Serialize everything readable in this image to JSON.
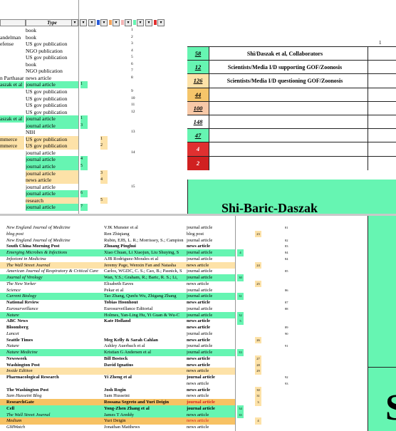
{
  "header": {
    "type_label": "Type",
    "col_number_top": "1"
  },
  "colors": {
    "green": "#66f5b2",
    "yellow": "#fde2a8",
    "red": "#e03030",
    "orange": "#f5a35a",
    "blue": "#2a5bd7",
    "pink": "#f3b4b4"
  },
  "top_rows": [
    {
      "src": "",
      "type": "book",
      "c1": "",
      "c2": "",
      "num": "1",
      "hl": ""
    },
    {
      "src": "andelman",
      "type": "book",
      "c1": "",
      "c2": "",
      "num": "2",
      "hl": ""
    },
    {
      "src": "efense",
      "type": "US gov publication",
      "c1": "",
      "c2": "",
      "num": "3",
      "hl": ""
    },
    {
      "src": "",
      "type": "NGO publication",
      "c1": "",
      "c2": "",
      "num": "4",
      "hl": ""
    },
    {
      "src": "",
      "type": "US gov publication",
      "c1": "",
      "c2": "",
      "num": "5",
      "hl": ""
    },
    {
      "src": "",
      "type": "book",
      "c1": "",
      "c2": "",
      "num": "6",
      "hl": ""
    },
    {
      "src": "",
      "type": "NGO publication",
      "c1": "",
      "c2": "",
      "num": "7",
      "hl": ""
    },
    {
      "src": "n Parthasar",
      "type": "news article",
      "c1": "",
      "c2": "",
      "num": "8",
      "hl": ""
    },
    {
      "src": "aszak et al",
      "type": "journal article",
      "c1": "1",
      "c2": "",
      "num": "",
      "hl": "g"
    },
    {
      "src": "",
      "type": "US gov publication",
      "c1": "",
      "c2": "",
      "num": "9",
      "hl": ""
    },
    {
      "src": "",
      "type": "US gov publication",
      "c1": "",
      "c2": "",
      "num": "10",
      "hl": ""
    },
    {
      "src": "",
      "type": "US gov publication",
      "c1": "",
      "c2": "",
      "num": "11",
      "hl": ""
    },
    {
      "src": "",
      "type": "US gov publication",
      "c1": "",
      "c2": "",
      "num": "12",
      "hl": ""
    },
    {
      "src": "aszak et al",
      "type": "journal article",
      "c1": "1",
      "c2": "",
      "num": "",
      "hl": "g"
    },
    {
      "src": "",
      "type": "journal article",
      "c1": "3",
      "c2": "",
      "num": "",
      "hl": "g"
    },
    {
      "src": "",
      "type": "NIH",
      "c1": "",
      "c2": "",
      "num": "13",
      "hl": ""
    },
    {
      "src": "mmerce",
      "type": "US gov publication",
      "c1": "",
      "c2": "1",
      "num": "",
      "hl": "y"
    },
    {
      "src": "mmerce",
      "type": "US gov publication",
      "c1": "",
      "c2": "2",
      "num": "",
      "hl": "y"
    },
    {
      "src": "",
      "type": "journal article",
      "c1": "",
      "c2": "",
      "num": "14",
      "hl": ""
    },
    {
      "src": "",
      "type": "journal article",
      "c1": "4",
      "c2": "",
      "num": "",
      "hl": "g"
    },
    {
      "src": "",
      "type": "journal article",
      "c1": "5",
      "c2": "",
      "num": "",
      "hl": "g"
    },
    {
      "src": "",
      "type": "journal article",
      "c1": "",
      "c2": "3",
      "num": "",
      "hl": "y"
    },
    {
      "src": "",
      "type": "news article",
      "c1": "",
      "c2": "4",
      "num": "",
      "hl": "y"
    },
    {
      "src": "",
      "type": "journal article",
      "c1": "",
      "c2": "",
      "num": "15",
      "hl": ""
    },
    {
      "src": "",
      "type": "journal article",
      "c1": "6",
      "c2": "",
      "num": "",
      "hl": "g"
    },
    {
      "src": "",
      "type": "research",
      "c1": "",
      "c2": "5",
      "num": "",
      "hl": "y"
    },
    {
      "src": "",
      "type": "journal article",
      "c1": "7",
      "c2": "",
      "num": "",
      "hl": "g"
    }
  ],
  "legend": [
    {
      "count": "58",
      "label": "Shi/Daszak et al, Collaborators",
      "color": "#66f5b2"
    },
    {
      "count": "12",
      "label": "Scientists/Media I/D supporting GOF/Zoonosis",
      "color": "#66f5b2"
    },
    {
      "count": "126",
      "label": "Scientists/Media I/D questioning GOF/Zoonosis",
      "color": "#fde2a8"
    },
    {
      "count": "44",
      "label": "",
      "color": "#f5c56a"
    },
    {
      "count": "100",
      "label": "",
      "color": "#f8c9a8"
    },
    {
      "count": "148",
      "label": "",
      "color": "#ffffff"
    },
    {
      "count": "47",
      "label": "",
      "color": "#66f5b2"
    },
    {
      "count": "4",
      "label": "",
      "color": "#e03030"
    },
    {
      "count": "2",
      "label": "",
      "color": "#d02020"
    }
  ],
  "banner": {
    "text": "Shi-Baric-Daszak"
  },
  "right_big_letter": "S",
  "bottom_rows": [
    {
      "s": "New England Journal of Medicine",
      "a": "VJK Munster et al",
      "t": "journal article",
      "b": false,
      "k1": "",
      "k2": "",
      "n": "81",
      "hl": ""
    },
    {
      "s": "blog post",
      "a": "Ren Zhiqiang",
      "t": "blog post",
      "b": false,
      "k1": "",
      "k2": "23",
      "n": "",
      "hl": ""
    },
    {
      "s": "New England Journal of Medicine",
      "a": "Rubin, EJB, L. R.; Morrissey, S.; Campion",
      "t": "journal article",
      "b": false,
      "k1": "",
      "k2": "",
      "n": "82",
      "hl": ""
    },
    {
      "s": "South China Morning Post",
      "a": "Zhuang Pinghui",
      "t": "news article",
      "b": true,
      "k1": "",
      "k2": "",
      "n": "83",
      "hl": ""
    },
    {
      "s": "Emerging Microbes & Infections",
      "a": "Xiao Chuan, Li Xiaojun, Liu Shuying, S",
      "t": "journal article",
      "b": false,
      "k1": "4",
      "k2": "",
      "n": "84",
      "hl": "g"
    },
    {
      "s": "Infezioni in Medicina",
      "a": "AJB Rodriguez-Morales et al",
      "t": "journal article",
      "b": false,
      "k1": "",
      "k2": "",
      "n": "84",
      "hl": ""
    },
    {
      "s": "The Wall Street Journal",
      "a": "Jeremy Page, Wenxin Fan and Natasha",
      "t": "news article",
      "b": false,
      "k1": "",
      "k2": "24",
      "n": "",
      "hl": "y"
    },
    {
      "s": "American Journal of Respiratory & Critical Care",
      "a": "Carlos, WGDC, C. S.; Cao, B.; Pasnick, S",
      "t": "journal article",
      "b": false,
      "k1": "",
      "k2": "",
      "n": "85",
      "hl": ""
    },
    {
      "s": "Journal of Virology",
      "a": "Wan, Y.S.; Graham, R.; Baric, R. S.; Li,",
      "t": "journal article",
      "b": false,
      "k1": "30",
      "k2": "",
      "n": "",
      "hl": "g"
    },
    {
      "s": "The New Yorker",
      "a": "Elisabeth Eaves",
      "t": "news article",
      "b": false,
      "k1": "",
      "k2": "25",
      "n": "",
      "hl": ""
    },
    {
      "s": "Science",
      "a": "Pekar et al",
      "t": "journal article",
      "b": false,
      "k1": "",
      "k2": "",
      "n": "86",
      "hl": ""
    },
    {
      "s": "Current Biology",
      "a": "Tao Zhang, Qunfu Wu, Zhigang Zhang",
      "t": "journal article",
      "b": false,
      "k1": "31",
      "k2": "",
      "n": "",
      "hl": "g"
    },
    {
      "s": "National Review",
      "a": "Tobias Hoonhout",
      "t": "news article",
      "b": true,
      "k1": "",
      "k2": "",
      "n": "87",
      "hl": ""
    },
    {
      "s": "Eurosurveillance",
      "a": "Eurosurveillance Editorial",
      "t": "journal article",
      "b": false,
      "k1": "",
      "k2": "",
      "n": "88",
      "hl": ""
    },
    {
      "s": "Nature",
      "a": "Holmes, Yan-Ling Hu, Yi Guan & Wu-C",
      "t": "journal article",
      "b": false,
      "k1": "32",
      "k2": "",
      "n": "",
      "hl": "g"
    },
    {
      "s": "ABC News",
      "a": "Kate Holland",
      "t": "news article",
      "b": true,
      "k1": "5",
      "k2": "",
      "n": "",
      "hl": ""
    },
    {
      "s": "Bloomberg",
      "a": "",
      "t": "news article",
      "b": true,
      "k1": "",
      "k2": "",
      "n": "89",
      "hl": ""
    },
    {
      "s": "Lancet",
      "a": "",
      "t": "journal article",
      "b": false,
      "k1": "",
      "k2": "",
      "n": "90",
      "hl": ""
    },
    {
      "s": "Seattle Times",
      "a": "Meg Kelly & Sarah Cahlan",
      "t": "news article",
      "b": true,
      "k1": "",
      "k2": "26",
      "n": "",
      "hl": ""
    },
    {
      "s": "Nature",
      "a": "Ashley Auerbach et al",
      "t": "journal article",
      "b": false,
      "k1": "",
      "k2": "",
      "n": "91",
      "hl": ""
    },
    {
      "s": "Nature Medicine",
      "a": "Kristian G Andersen et al",
      "t": "journal article",
      "b": false,
      "k1": "33",
      "k2": "",
      "n": "",
      "hl": "g"
    },
    {
      "s": "Newsweek",
      "a": "Bill Bostock",
      "t": "news article",
      "b": true,
      "k1": "",
      "k2": "27",
      "n": "",
      "hl": ""
    },
    {
      "s": "Washington Post",
      "a": "David Ignatius",
      "t": "news article",
      "b": true,
      "k1": "",
      "k2": "28",
      "n": "",
      "hl": ""
    },
    {
      "s": "Inside Edition",
      "a": "",
      "t": "news article",
      "b": false,
      "k1": "",
      "k2": "29",
      "n": "",
      "hl": "y"
    },
    {
      "s": "Pharmacological Research",
      "a": "Yi Zheng et al",
      "t": "journal article",
      "b": true,
      "k1": "",
      "k2": "",
      "n": "92",
      "hl": ""
    },
    {
      "s": "",
      "a": "",
      "t": "news article",
      "b": false,
      "k1": "",
      "k2": "",
      "n": "93",
      "hl": ""
    },
    {
      "s": "The Washington Post",
      "a": "Josh Rogin",
      "t": "news article",
      "b": true,
      "k1": "",
      "k2": "30",
      "n": "",
      "hl": ""
    },
    {
      "s": "Sam Husseini Blog",
      "a": "Sam Husseini",
      "t": "news article",
      "b": false,
      "k1": "",
      "k2": "31",
      "n": "",
      "hl": ""
    },
    {
      "s": "ResearchGate",
      "a": "Rossana Segreto and Yuri Deigin",
      "t": "journal article",
      "b": true,
      "k1": "",
      "k2": "3",
      "n": "",
      "hl": "o"
    },
    {
      "s": "Cell",
      "a": "Yong-Zhen Zhang et al",
      "t": "journal article",
      "b": true,
      "k1": "34",
      "k2": "",
      "n": "",
      "hl": "g"
    },
    {
      "s": "The Wall Street Journal",
      "a": "James T Areddy",
      "t": "news article",
      "b": false,
      "k1": "35",
      "k2": "",
      "n": "",
      "hl": "g"
    },
    {
      "s": "Medium",
      "a": "Yuri Deigin",
      "t": "news article",
      "b": false,
      "k1": "",
      "k2": "4",
      "n": "",
      "hl": "o"
    },
    {
      "s": "GMWatch",
      "a": "Jonathan Matthews",
      "t": "news article",
      "b": false,
      "k1": "",
      "k2": "",
      "n": "",
      "hl": ""
    }
  ]
}
